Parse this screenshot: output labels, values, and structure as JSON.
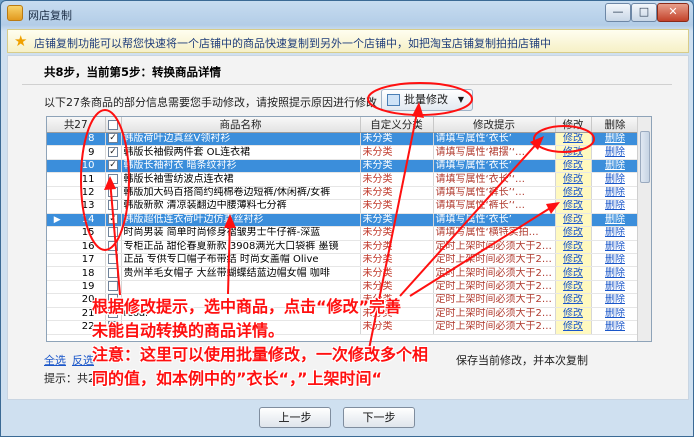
{
  "window": {
    "title": "网店复制",
    "min": "—",
    "max": "□",
    "close": "✕"
  },
  "infobar": {
    "text": "店铺复制功能可以帮您快速将一个店铺中的商品快速复制到另外一个店铺中，如把淘宝店铺复制拍拍店铺中"
  },
  "step": {
    "title": "共8步，当前第5步：转换商品详情"
  },
  "hint": {
    "text": "以下27条商品的部分信息需要您手动修改，请按照提示原因进行修改"
  },
  "bulk_button": "批量修改",
  "table": {
    "headers": [
      "共27",
      "",
      "商品名称",
      "自定义分类",
      "修改提示",
      "修改",
      "删除"
    ],
    "rows": [
      {
        "num": "8",
        "checked": true,
        "name": "韩版荷叶边真丝V领衬衫",
        "cat": "未分类",
        "tip": "请填写属性‘衣长’",
        "edit": "修改",
        "del": "删除",
        "selected": true
      },
      {
        "num": "9",
        "checked": true,
        "name": "韩版长袖假两件套 OL连衣裙",
        "cat": "未分类",
        "tip": "请填写属性‘裙摆’‘…",
        "edit": "修改",
        "del": "删除",
        "selected": false
      },
      {
        "num": "10",
        "checked": true,
        "name": "韩版长袖衬衣 暗条纹衬衫",
        "cat": "未分类",
        "tip": "请填写属性‘衣长’",
        "edit": "修改",
        "del": "删除",
        "selected": true
      },
      {
        "num": "11",
        "checked": false,
        "name": "韩版长袖雪纺波点连衣裙",
        "cat": "未分类",
        "tip": "请填写属性‘衣长’‘…",
        "edit": "修改",
        "del": "删除",
        "selected": false
      },
      {
        "num": "12",
        "checked": false,
        "name": "韩版加大码百搭简约纯棉卷边短裤/休闲裤/女裤",
        "cat": "未分类",
        "tip": "请填写属性‘裤长’‘…",
        "edit": "修改",
        "del": "删除",
        "selected": false
      },
      {
        "num": "13",
        "checked": false,
        "name": "韩版新款 清凉装翻边中腰薄料七分裤",
        "cat": "未分类",
        "tip": "请填写属性‘裤长’‘…",
        "edit": "修改",
        "del": "删除",
        "selected": false
      },
      {
        "num": "14",
        "checked": true,
        "name": "韩版超低连衣荷叶边仿真丝衬衫",
        "cat": "未分类",
        "tip": "请填写属性‘衣长’",
        "edit": "修改",
        "del": "删除",
        "selected": true
      },
      {
        "num": "15",
        "checked": false,
        "name": "时尚男装 简单时尚修身褶皱男士牛仔裤-深蓝",
        "cat": "未分类",
        "tip": "请填写属性‘横特实拍…",
        "edit": "修改",
        "del": "删除",
        "selected": false
      },
      {
        "num": "16",
        "checked": false,
        "name": "专柜正品 甜伦春夏新款 3908满光大口袋裤 墨镜",
        "cat": "未分类",
        "tip": "定时上架时间必须大于2…",
        "edit": "修改",
        "del": "删除",
        "selected": false
      },
      {
        "num": "17",
        "checked": false,
        "name": "正品 专供专口帽子布带结 时尚女盖帽 Olive",
        "cat": "未分类",
        "tip": "定时上架时间必须大于2…",
        "edit": "修改",
        "del": "删除",
        "selected": false
      },
      {
        "num": "18",
        "checked": false,
        "name": "贵州羊毛女帽子 大丝带蝴蝶结蓝边帽女帽 咖啡",
        "cat": "未分类",
        "tip": "定时上架时间必须大于2…",
        "edit": "修改",
        "del": "删除",
        "selected": false
      },
      {
        "num": "19",
        "checked": false,
        "name": "",
        "cat": "未分类",
        "tip": "定时上架时间必须大于2…",
        "edit": "修改",
        "del": "删除",
        "selected": false
      },
      {
        "num": "20",
        "checked": false,
        "name": "",
        "cat": "未分类",
        "tip": "定时上架时间必须大于2…",
        "edit": "修改",
        "del": "删除",
        "selected": false
      },
      {
        "num": "21",
        "checked": false,
        "name": "rcoal",
        "cat": "未分类",
        "tip": "定时上架时间必须大于2…",
        "edit": "修改",
        "del": "删除",
        "selected": false
      },
      {
        "num": "22",
        "checked": false,
        "name": "",
        "cat": "未分类",
        "tip": "定时上架时间必须大于2…",
        "edit": "修改",
        "del": "删除",
        "selected": false
      }
    ]
  },
  "footer": {
    "select_all": "全选",
    "invert": "反选",
    "note": "保存当前修改，并本次复制",
    "hint": "提示：共2"
  },
  "buttons": {
    "prev": "上一步",
    "next": "下一步"
  },
  "annotation": {
    "line1": "根据修改提示，选中商品，点击“修改”完善",
    "line2": "未能自动转换的商品详情。",
    "line3": "注意：这里可以使用批量修改，一次修改多个相",
    "line4": "同的值，如本例中的”衣长“，”上架时间“"
  },
  "colors": {
    "annotation": "#ff1010",
    "selected_row": "#3b8edb",
    "link": "#1a56c9"
  }
}
